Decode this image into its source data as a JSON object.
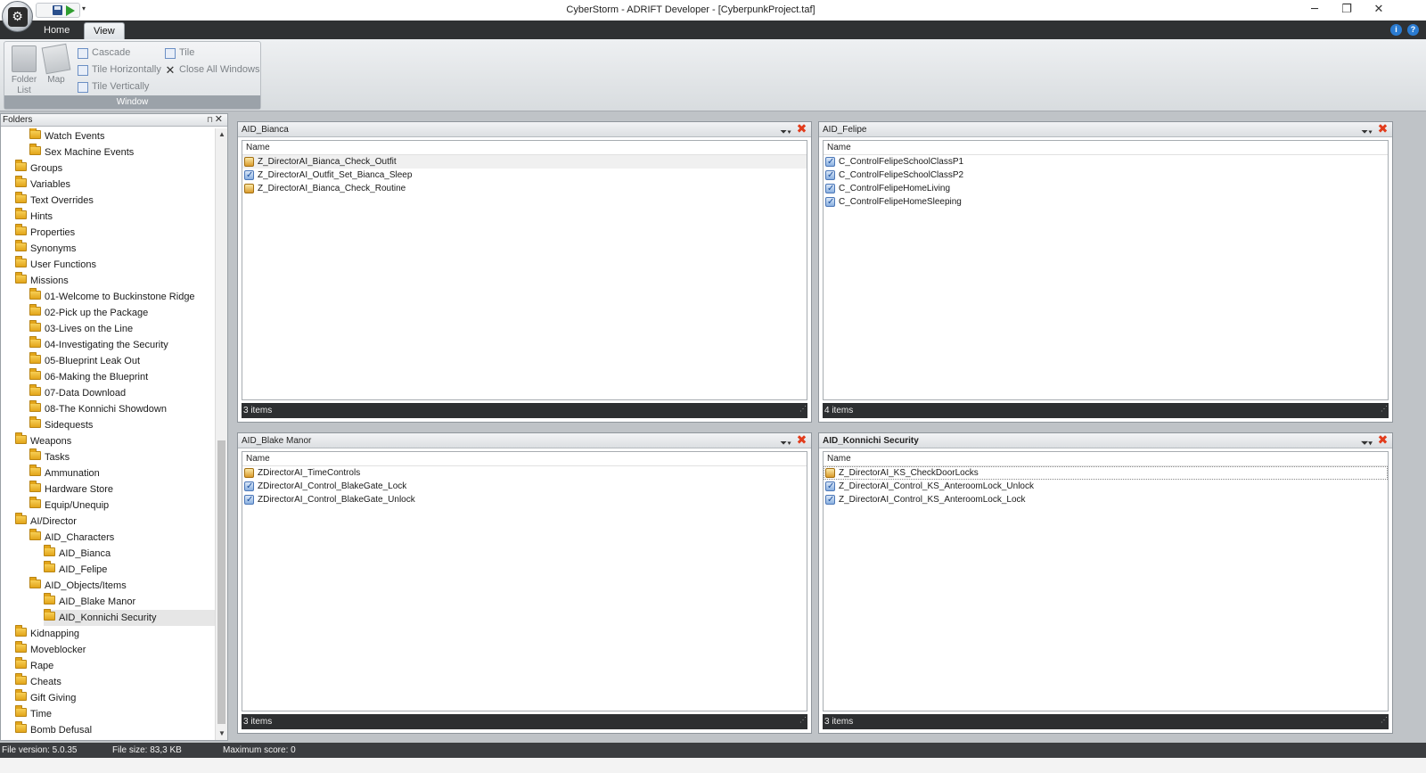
{
  "window": {
    "title": "CyberStorm - ADRIFT Developer - [CyberpunkProject.taf]",
    "minimize": "─",
    "restore": "❐",
    "close": "✕"
  },
  "qat": {
    "more": "▾"
  },
  "ribbon": {
    "tabs": [
      {
        "label": "Home",
        "active": false
      },
      {
        "label": "View",
        "active": true
      }
    ],
    "group_label": "Window",
    "folder_list_label_1": "Folder",
    "folder_list_label_2": "List",
    "map_label": "Map",
    "cascade": "Cascade",
    "tile": "Tile",
    "tile_horizontally": "Tile Horizontally",
    "close_all_windows": "Close All Windows",
    "tile_vertically": "Tile Vertically"
  },
  "folders": {
    "header": "Folders",
    "items": [
      {
        "label": "Watch Events",
        "level": 1
      },
      {
        "label": "Sex Machine Events",
        "level": 1
      },
      {
        "label": "Groups",
        "level": 0
      },
      {
        "label": "Variables",
        "level": 0
      },
      {
        "label": "Text Overrides",
        "level": 0
      },
      {
        "label": "Hints",
        "level": 0
      },
      {
        "label": "Properties",
        "level": 0
      },
      {
        "label": "Synonyms",
        "level": 0
      },
      {
        "label": "User Functions",
        "level": 0
      },
      {
        "label": "Missions",
        "level": 0
      },
      {
        "label": "01-Welcome to Buckinstone Ridge",
        "level": 1
      },
      {
        "label": "02-Pick up the Package",
        "level": 1
      },
      {
        "label": "03-Lives on the Line",
        "level": 1
      },
      {
        "label": "04-Investigating the Security",
        "level": 1
      },
      {
        "label": "05-Blueprint Leak Out",
        "level": 1
      },
      {
        "label": "06-Making the Blueprint",
        "level": 1
      },
      {
        "label": "07-Data Download",
        "level": 1
      },
      {
        "label": "08-The Konnichi Showdown",
        "level": 1
      },
      {
        "label": "Sidequests",
        "level": 1
      },
      {
        "label": "Weapons",
        "level": 0
      },
      {
        "label": "Tasks",
        "level": 1
      },
      {
        "label": "Ammunation",
        "level": 1
      },
      {
        "label": "Hardware Store",
        "level": 1
      },
      {
        "label": "Equip/Unequip",
        "level": 1
      },
      {
        "label": "AI/Director",
        "level": 0
      },
      {
        "label": "AID_Characters",
        "level": 1
      },
      {
        "label": "AID_Bianca",
        "level": 2
      },
      {
        "label": "AID_Felipe",
        "level": 2
      },
      {
        "label": "AID_Objects/Items",
        "level": 1
      },
      {
        "label": "AID_Blake Manor",
        "level": 2
      },
      {
        "label": "AID_Konnichi Security",
        "level": 2,
        "selected": true
      },
      {
        "label": "Kidnapping",
        "level": 0
      },
      {
        "label": "Moveblocker",
        "level": 0
      },
      {
        "label": "Rape",
        "level": 0
      },
      {
        "label": "Cheats",
        "level": 0
      },
      {
        "label": "Gift Giving",
        "level": 0
      },
      {
        "label": "Time",
        "level": 0
      },
      {
        "label": "Bomb Defusal",
        "level": 0
      }
    ]
  },
  "windows": [
    {
      "title": "AID_Bianca",
      "active": false,
      "column": "Name",
      "rows": [
        {
          "label": "Z_DirectorAI_Bianca_Check_Outfit",
          "icon": "event-task-icon",
          "hl": true
        },
        {
          "label": "Z_DirectorAI_Outfit_Set_Bianca_Sleep",
          "icon": "checked-task-icon"
        },
        {
          "label": "Z_DirectorAI_Bianca_Check_Routine",
          "icon": "event-task-icon"
        }
      ],
      "status": "3 items"
    },
    {
      "title": "AID_Felipe",
      "active": false,
      "column": "Name",
      "rows": [
        {
          "label": "C_ControlFelipeSchoolClassP1",
          "icon": "checked-task-icon"
        },
        {
          "label": "C_ControlFelipeSchoolClassP2",
          "icon": "checked-task-icon"
        },
        {
          "label": "C_ControlFelipeHomeLiving",
          "icon": "checked-task-icon"
        },
        {
          "label": "C_ControlFelipeHomeSleeping",
          "icon": "checked-task-icon"
        }
      ],
      "status": "4 items"
    },
    {
      "title": "AID_Blake Manor",
      "active": false,
      "column": "Name",
      "rows": [
        {
          "label": "ZDirectorAI_TimeControls",
          "icon": "event-task-icon"
        },
        {
          "label": "ZDirectorAI_Control_BlakeGate_Lock",
          "icon": "checked-task-icon"
        },
        {
          "label": "ZDirectorAI_Control_BlakeGate_Unlock",
          "icon": "checked-task-icon"
        }
      ],
      "status": "3 items"
    },
    {
      "title": "AID_Konnichi Security",
      "active": true,
      "column": "Name",
      "rows": [
        {
          "label": "Z_DirectorAI_KS_CheckDoorLocks",
          "icon": "event-task-icon",
          "focus": true
        },
        {
          "label": "Z_DirectorAI_Control_KS_AnteroomLock_Unlock",
          "icon": "checked-task-icon"
        },
        {
          "label": "Z_DirectorAI_Control_KS_AnteroomLock_Lock",
          "icon": "checked-task-icon"
        }
      ],
      "status": "3 items"
    }
  ],
  "statusbar": {
    "file_version": "File version: 5.0.35",
    "file_size": "File size: 83,3 KB",
    "max_score": "Maximum score: 0"
  }
}
